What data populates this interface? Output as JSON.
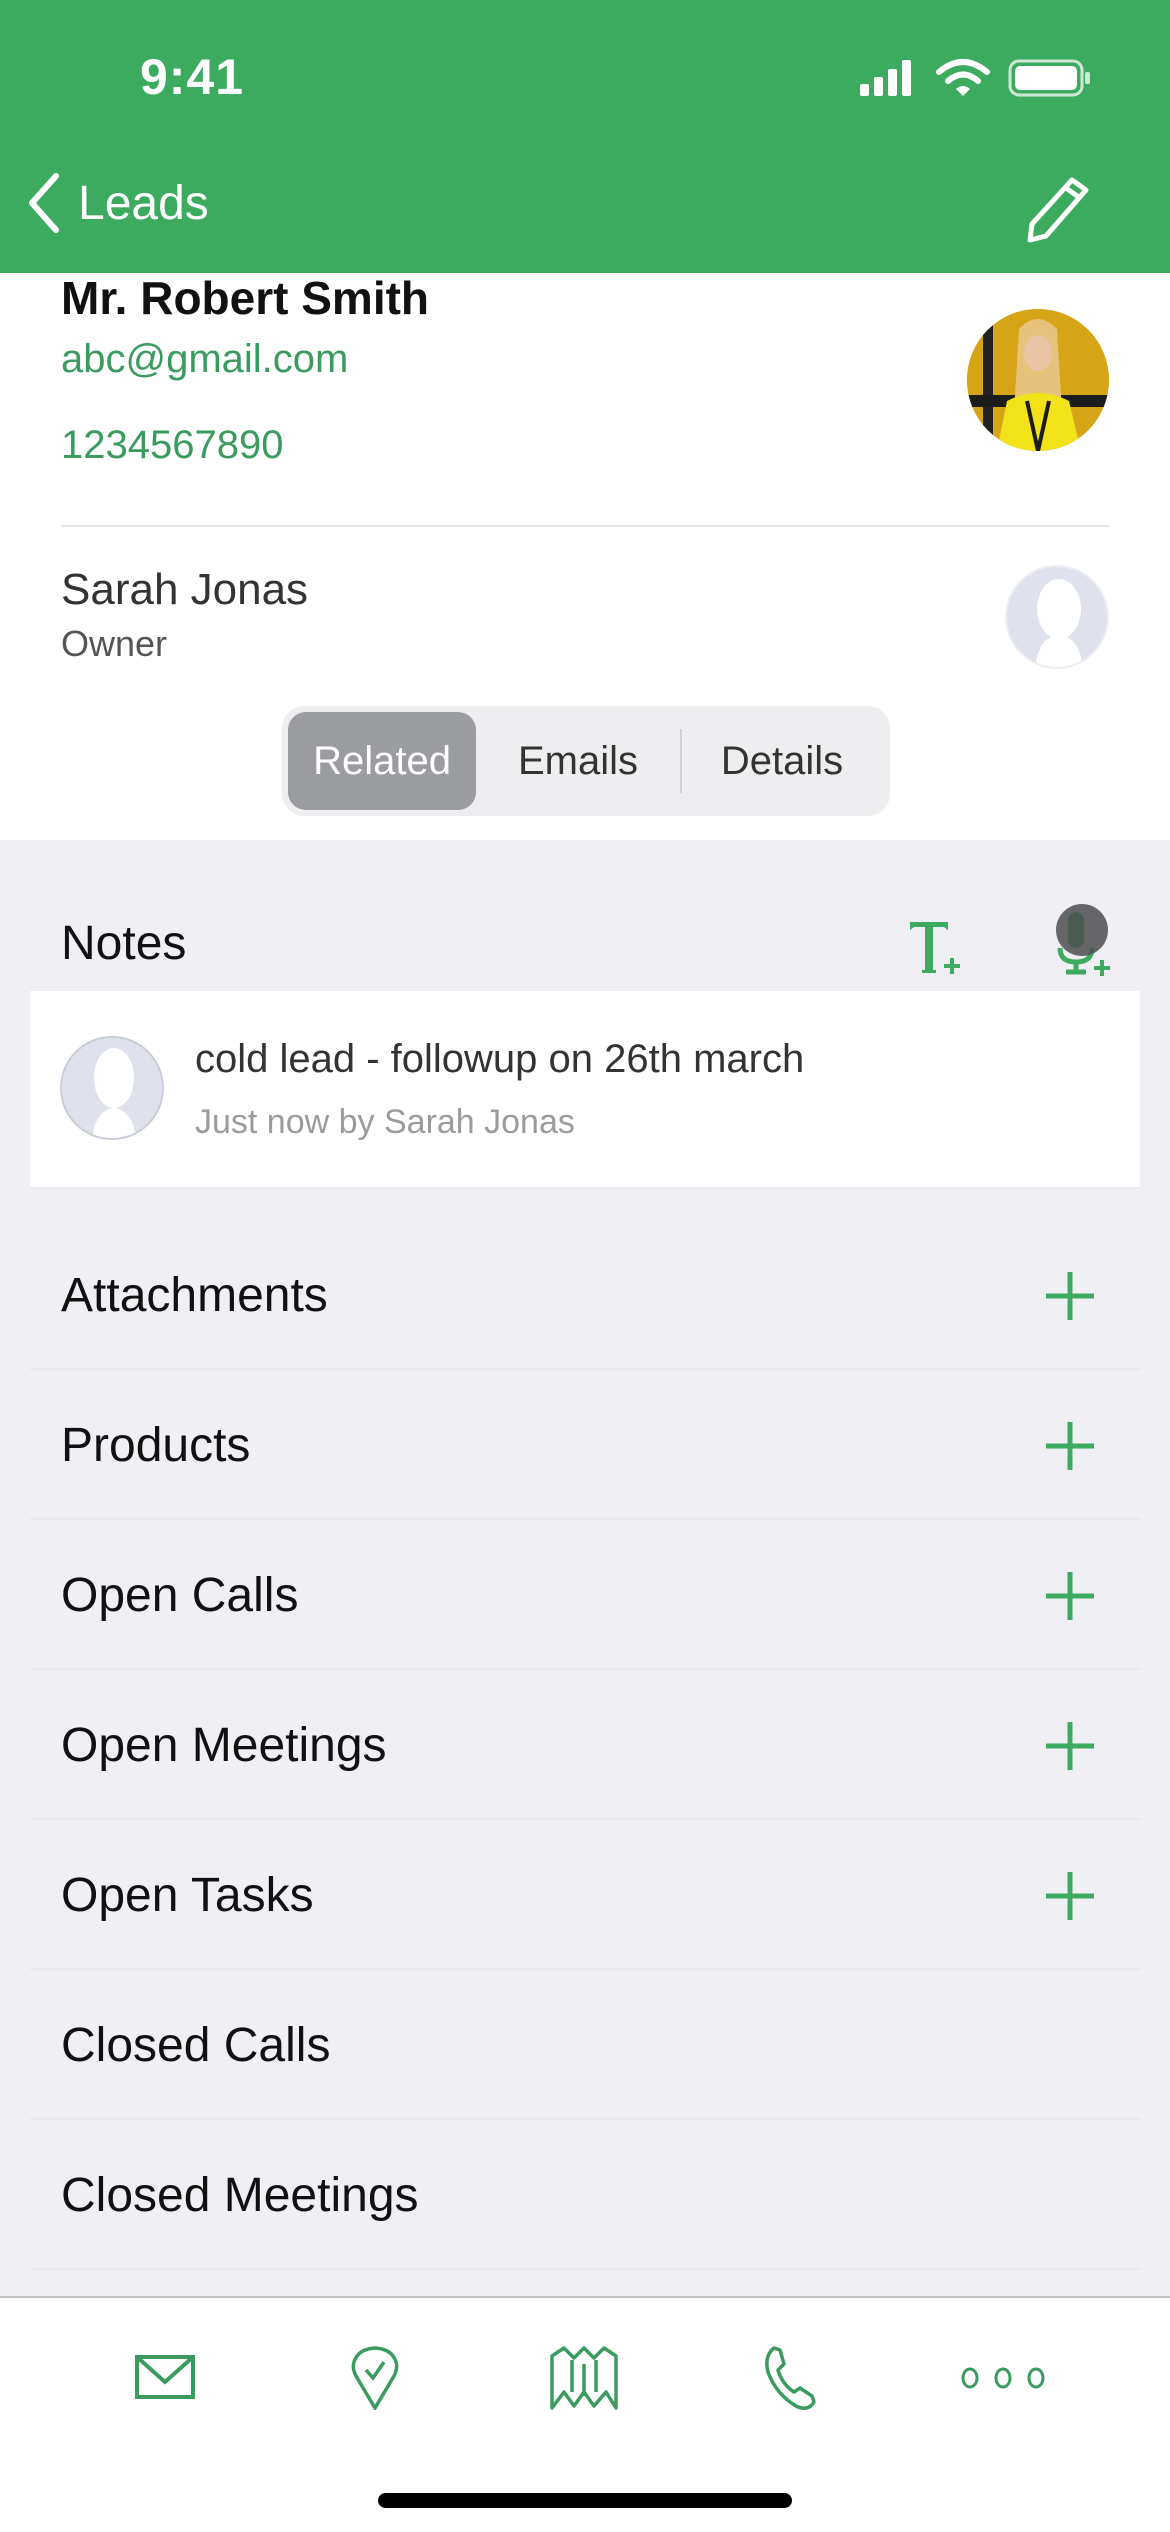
{
  "status_bar": {
    "time": "9:41"
  },
  "nav": {
    "back_label": "Leads",
    "back_icon": "chevron-left-icon",
    "edit_icon": "pencil-icon"
  },
  "lead": {
    "name": "Mr. Robert Smith",
    "email": "abc@gmail.com",
    "phone": "1234567890"
  },
  "owner": {
    "name": "Sarah Jonas",
    "role": "Owner"
  },
  "segments": [
    {
      "label": "Related",
      "active": true
    },
    {
      "label": "Emails",
      "active": false
    },
    {
      "label": "Details",
      "active": false
    }
  ],
  "notes": {
    "title": "Notes",
    "items": [
      {
        "text": "cold lead - followup on 26th march",
        "meta": "Just now by Sarah Jonas"
      }
    ]
  },
  "related": [
    {
      "label": "Attachments",
      "addable": true
    },
    {
      "label": "Products",
      "addable": true
    },
    {
      "label": "Open Calls",
      "addable": true
    },
    {
      "label": "Open Meetings",
      "addable": true
    },
    {
      "label": "Open Tasks",
      "addable": true
    },
    {
      "label": "Closed Calls",
      "addable": false
    },
    {
      "label": "Closed Meetings",
      "addable": false
    }
  ],
  "tabbar": [
    "mail-icon",
    "location-check-icon",
    "map-icon",
    "phone-icon",
    "more-icon"
  ],
  "colors": {
    "brand": "#3dab5f",
    "link": "#3b9b5f"
  }
}
